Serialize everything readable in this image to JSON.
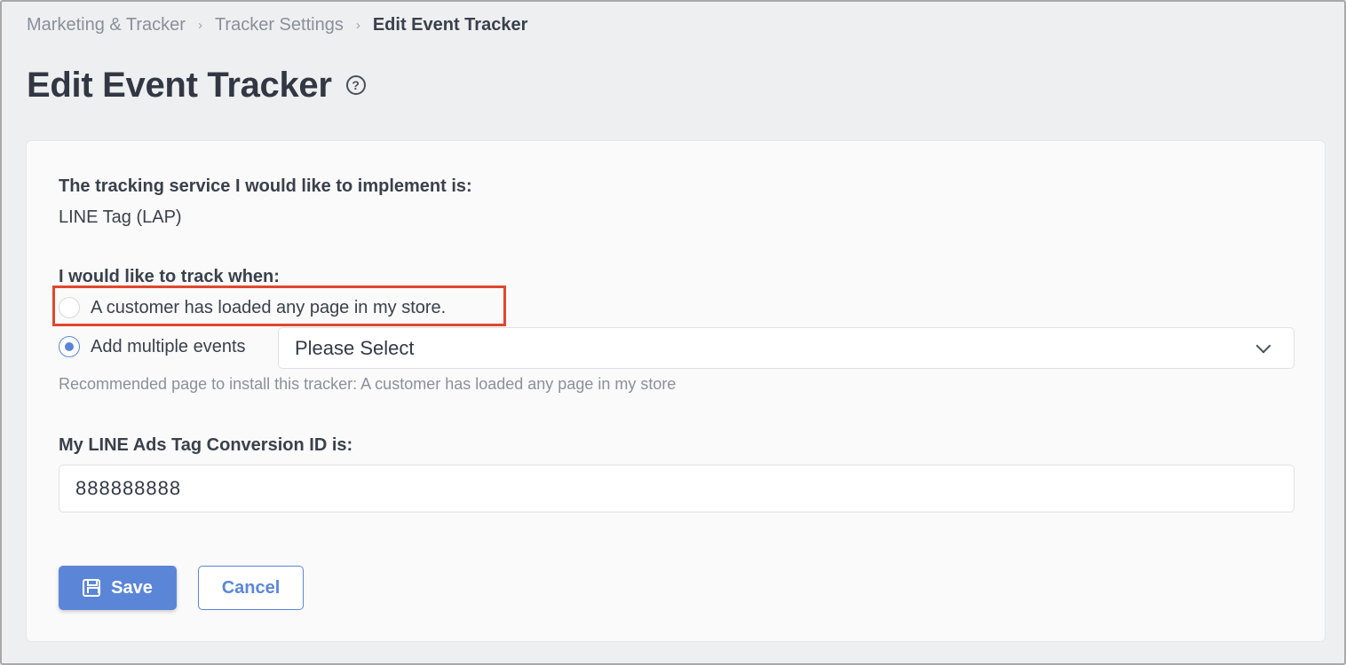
{
  "breadcrumb": {
    "items": [
      "Marketing & Tracker",
      "Tracker Settings"
    ],
    "current": "Edit Event Tracker",
    "separator": "›"
  },
  "page": {
    "title": "Edit Event Tracker",
    "help_icon": "?"
  },
  "form": {
    "service_label": "The tracking service I would like to implement is:",
    "service_value": "LINE Tag (LAP)",
    "track_label": "I would like to track when:",
    "option_any_page": "A customer has loaded any page in my store.",
    "option_multiple": "Add multiple events",
    "select_value": "Please Select",
    "hint": "Recommended page to install this tracker: A customer has loaded any page in my store",
    "conversion_label": "My LINE Ads Tag Conversion ID is:",
    "conversion_value": "888888888"
  },
  "buttons": {
    "save": "Save",
    "cancel": "Cancel"
  },
  "colors": {
    "accent": "#5b86d8",
    "highlight": "#e0472f"
  }
}
